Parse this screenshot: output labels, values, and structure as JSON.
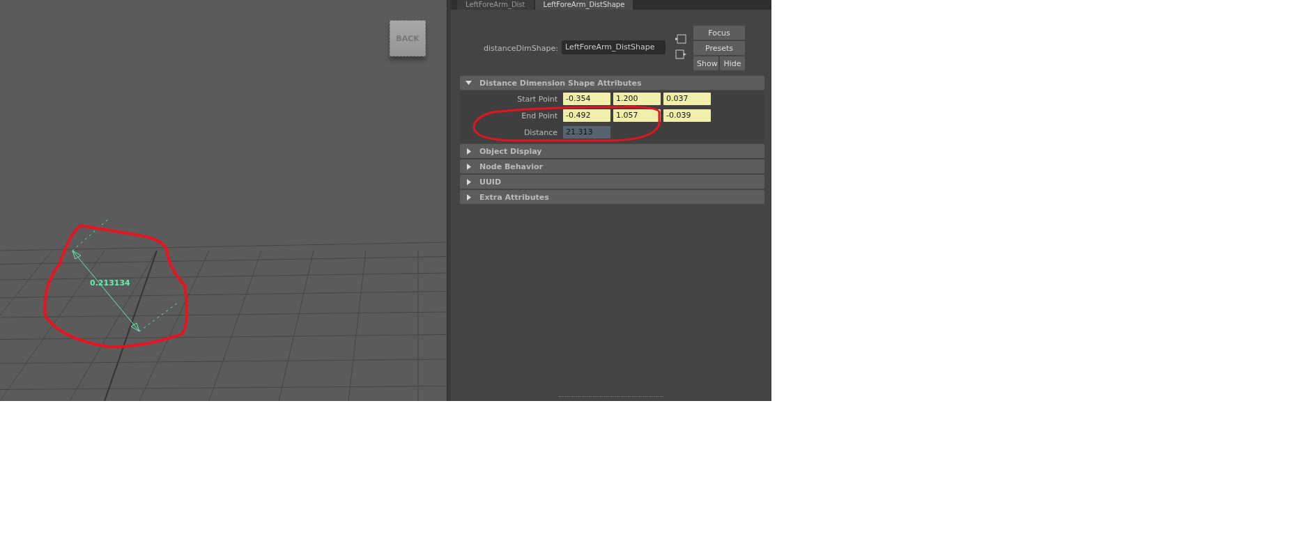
{
  "viewport": {
    "view_cube_label": "BACK",
    "dimension_label": "0.213134"
  },
  "attribute_editor": {
    "tabs": [
      {
        "label": "LeftForeArm_Dist",
        "selected": false
      },
      {
        "label": "LeftForeArm_DistShape",
        "selected": true
      }
    ],
    "node": {
      "label": "distanceDimShape:",
      "value": "LeftForeArm_DistShape"
    },
    "buttons": [
      [
        "Focus"
      ],
      [
        "Presets"
      ],
      [
        "Show",
        "Hide"
      ]
    ],
    "sections": [
      {
        "title": "Distance Dimension Shape Attributes",
        "expanded": true,
        "attributes": [
          {
            "label": "Start Point",
            "kind": "keyed",
            "values": [
              "-0.354",
              "1.200",
              "0.037"
            ]
          },
          {
            "label": "End Point",
            "kind": "keyed",
            "values": [
              "-0.492",
              "1.057",
              "-0.039"
            ]
          },
          {
            "label": "Distance",
            "kind": "computed",
            "values": [
              "21.313"
            ]
          }
        ]
      },
      {
        "title": "Object Display",
        "expanded": false
      },
      {
        "title": "Node Behavior",
        "expanded": false
      },
      {
        "title": "UUID",
        "expanded": false
      },
      {
        "title": "Extra Attributes",
        "expanded": false
      }
    ]
  }
}
